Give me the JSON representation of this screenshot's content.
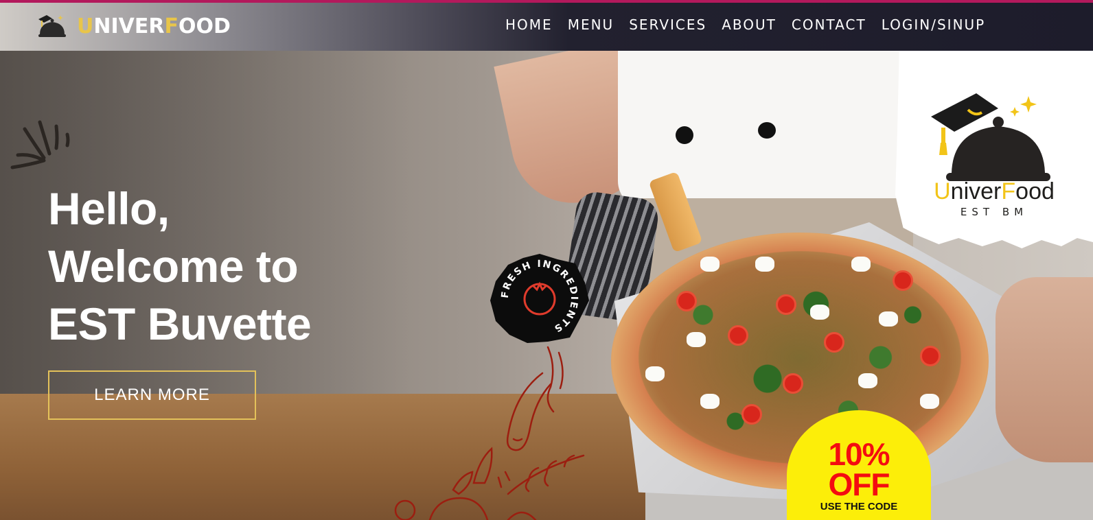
{
  "brand": {
    "logo_prefix_highlight": "U",
    "logo_mid": "NIVER",
    "logo_mid_highlight": "F",
    "logo_suffix": "OOD",
    "accent_color": "#e8c54a",
    "top_bar_color": "#b3195c"
  },
  "nav": {
    "items": [
      "HOME",
      "MENU",
      "SERVICES",
      "ABOUT",
      "CONTACT",
      "LOGIN/SINUP"
    ]
  },
  "hero": {
    "title_lines": [
      "Hello,",
      "Welcome to",
      "EST Buvette"
    ],
    "cta_label": "LEARN MORE"
  },
  "badge": {
    "text": "FRESH INGREDIENTS"
  },
  "corner_logo": {
    "name_highlight_1": "U",
    "name_part_1": "niver",
    "name_highlight_2": "F",
    "name_part_2": "ood",
    "tagline": "EST BM"
  },
  "offer": {
    "line1": "10%",
    "line2": "OFF",
    "line3": "USE THE CODE"
  },
  "icons": [
    "graduation-cloche-icon",
    "tomato-icon",
    "sparkle-icon"
  ]
}
